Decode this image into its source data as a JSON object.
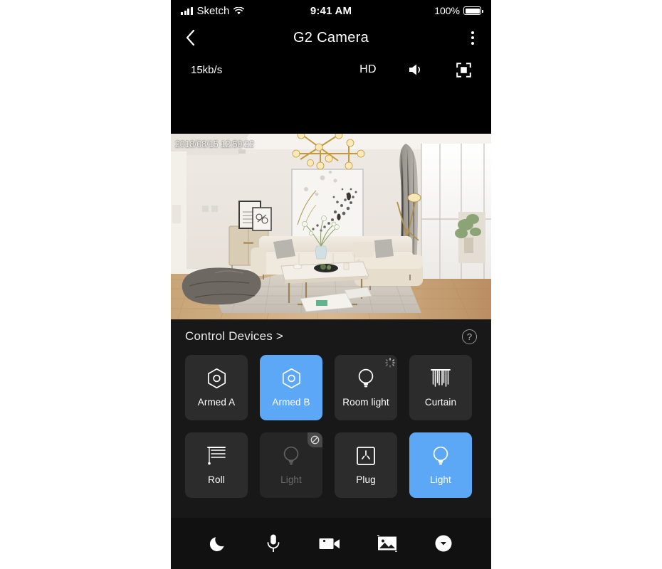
{
  "status_bar": {
    "carrier": "Sketch",
    "time": "9:41 AM",
    "battery_percent": "100%",
    "signal_icon": "cellular-signal-icon",
    "wifi_icon": "wifi-icon",
    "battery_icon": "battery-full-icon"
  },
  "nav_bar": {
    "title": "G2 Camera",
    "back_icon": "chevron-left-icon",
    "more_icon": "more-vertical-icon"
  },
  "video_toolbar": {
    "bitrate": "15kb/s",
    "quality": "HD",
    "speaker_icon": "speaker-on-icon",
    "fullscreen_icon": "fullscreen-icon"
  },
  "video": {
    "timestamp": "2018/08/15 12:50:22",
    "scene_description": "living-room-camera-feed"
  },
  "control_devices": {
    "header": "Control Devices >",
    "help_icon": "question-mark-icon",
    "help_label": "?",
    "accent_color": "#5ca8f7",
    "tile_color": "#2c2c2c",
    "tiles": [
      {
        "label": "Armed A",
        "icon": "shield-hexagon-icon",
        "state": "default",
        "badge": "none"
      },
      {
        "label": "Armed B",
        "icon": "shield-hexagon-icon",
        "state": "active",
        "badge": "none"
      },
      {
        "label": "Room light",
        "icon": "light-bulb-icon",
        "state": "default",
        "badge": "loading-spinner-icon"
      },
      {
        "label": "Curtain",
        "icon": "curtain-icon",
        "state": "default",
        "badge": "none"
      },
      {
        "label": "Roll",
        "icon": "roller-blind-icon",
        "state": "default",
        "badge": "none"
      },
      {
        "label": "Light",
        "icon": "light-bulb-icon",
        "state": "disabled",
        "badge": "offline-icon"
      },
      {
        "label": "Plug",
        "icon": "power-socket-icon",
        "state": "default",
        "badge": "none"
      },
      {
        "label": "Light",
        "icon": "light-bulb-icon",
        "state": "active",
        "badge": "none"
      }
    ]
  },
  "bottom_bar": {
    "buttons": [
      {
        "icon": "moon-icon",
        "name": "night-mode-button"
      },
      {
        "icon": "microphone-icon",
        "name": "talk-button"
      },
      {
        "icon": "video-camera-icon",
        "name": "record-button"
      },
      {
        "icon": "photo-icon",
        "name": "snapshot-button"
      },
      {
        "icon": "chevron-down-circle-icon",
        "name": "expand-button"
      }
    ]
  }
}
